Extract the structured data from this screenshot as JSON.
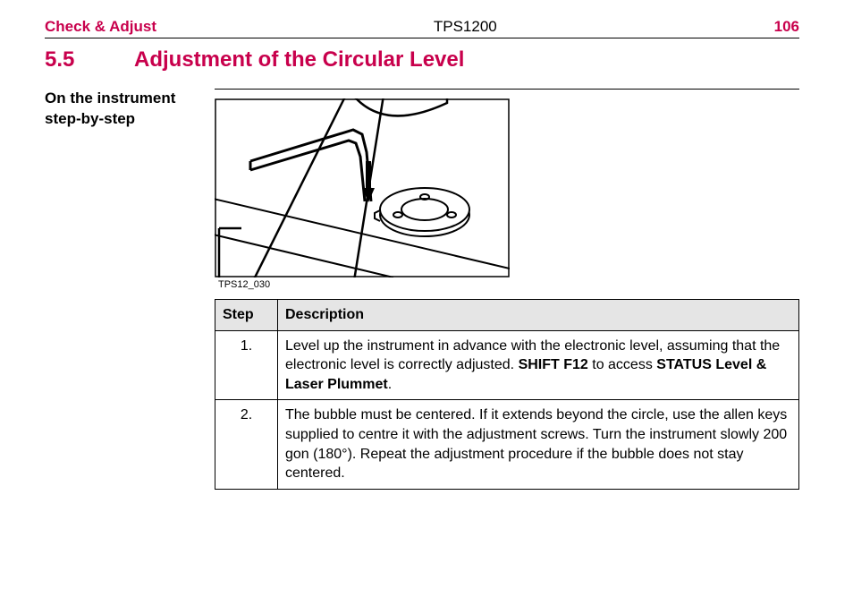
{
  "header": {
    "left": "Check & Adjust",
    "center": "TPS1200",
    "right": "106"
  },
  "section": {
    "number": "5.5",
    "title": "Adjustment of the Circular Level"
  },
  "side_label": "On the instrument step-by-step",
  "figure": {
    "caption": "TPS12_030"
  },
  "table": {
    "headers": {
      "step": "Step",
      "description": "Description"
    },
    "rows": [
      {
        "num": "1.",
        "desc_parts": [
          "Level up the instrument in advance with the electronic level, assuming that the electronic level is correctly adjusted. ",
          "SHIFT F12",
          " to access ",
          "STATUS Level & Laser Plummet",
          "."
        ]
      },
      {
        "num": "2.",
        "desc_parts": [
          "The bubble must be centered. If it extends beyond the circle, use the allen keys supplied to centre it with the adjustment screws. Turn the instrument slowly 200 gon (180°). Repeat the adjustment procedure if the bubble does not stay centered."
        ]
      }
    ]
  }
}
